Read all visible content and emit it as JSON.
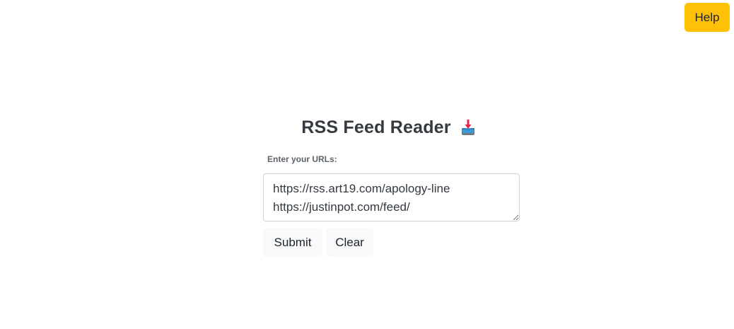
{
  "header": {
    "help_label": "Help"
  },
  "main": {
    "title": "RSS Feed Reader",
    "title_icon": "inbox-download-icon",
    "url_label": "Enter your URLs:",
    "url_input_value": "https://rss.art19.com/apology-line\nhttps://justinpot.com/feed/",
    "submit_label": "Submit",
    "clear_label": "Clear"
  },
  "colors": {
    "help_button": "#ffc107",
    "light_button": "#f8f9fa",
    "title_text": "#343a40"
  }
}
